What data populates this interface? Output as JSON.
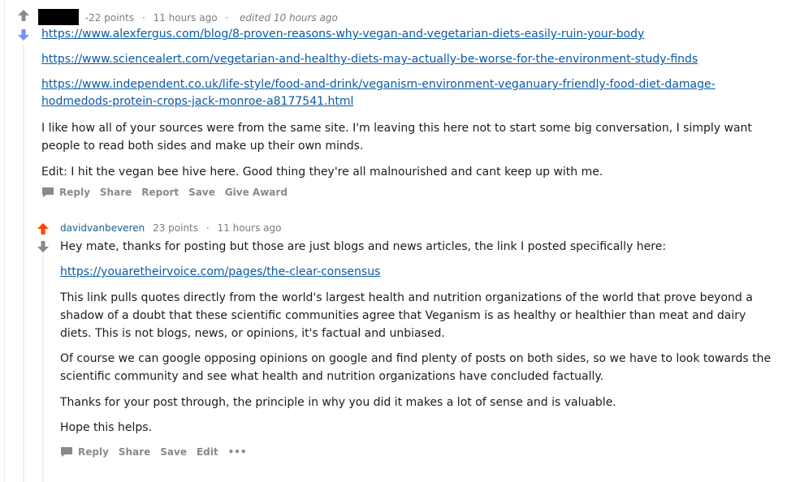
{
  "comment1": {
    "points": "-22 points",
    "time": "11 hours ago",
    "edited": "edited 10 hours ago",
    "link1": "https://www.alexfergus.com/blog/8-proven-reasons-why-vegan-and-vegetarian-diets-easily-ruin-your-body",
    "link2": "https://www.sciencealert.com/vegetarian-and-healthy-diets-may-actually-be-worse-for-the-environment-study-finds",
    "link3_line1": "https://www.independent.co.uk/life-style/food-and-drink/veganism-environment-veganuary-friendly-food-diet-damage-",
    "link3_line2": "hodmedods-protein-crops-jack-monroe-a8177541.html",
    "body1": "I like how all of your sources were from the same site. I'm leaving this here not to start some big conversation, I simply want people to read both sides and make up their own minds.",
    "body2": "Edit: I hit the vegan bee hive here. Good thing they're all malnourished and cant keep up with me.",
    "actions": {
      "reply": "Reply",
      "share": "Share",
      "report": "Report",
      "save": "Save",
      "award": "Give Award"
    }
  },
  "comment2": {
    "username": "davidvanbeveren",
    "points": "23 points",
    "time": "11 hours ago",
    "body1": "Hey mate, thanks for posting but those are just blogs and news articles, the link I posted specifically here:",
    "link": "https://youaretheirvoice.com/pages/the-clear-consensus",
    "body2": "This link pulls quotes directly from the world's largest health and nutrition organizations of the world that prove beyond a shadow of a doubt that these scientific communities agree that Veganism is as healthy or healthier than meat and dairy diets. This is not blogs, news, or opinions, it's factual and unbiased.",
    "body3": "Of course we can google opposing opinions on google and find plenty of posts on both sides, so we have to look towards the scientific community and see what health and nutrition organizations have concluded factually.",
    "body4": "Thanks for your post through, the principle in why you did it makes a lot of sense and is valuable.",
    "body5": "Hope this helps.",
    "actions": {
      "reply": "Reply",
      "share": "Share",
      "save": "Save",
      "edit": "Edit",
      "more": "•••"
    }
  },
  "colors": {
    "upvote_active": "#ff4500",
    "downvote_active": "#7193ff",
    "neutral": "#878a8c",
    "link": "#0b5aa6",
    "username": "#1a5e8e"
  }
}
